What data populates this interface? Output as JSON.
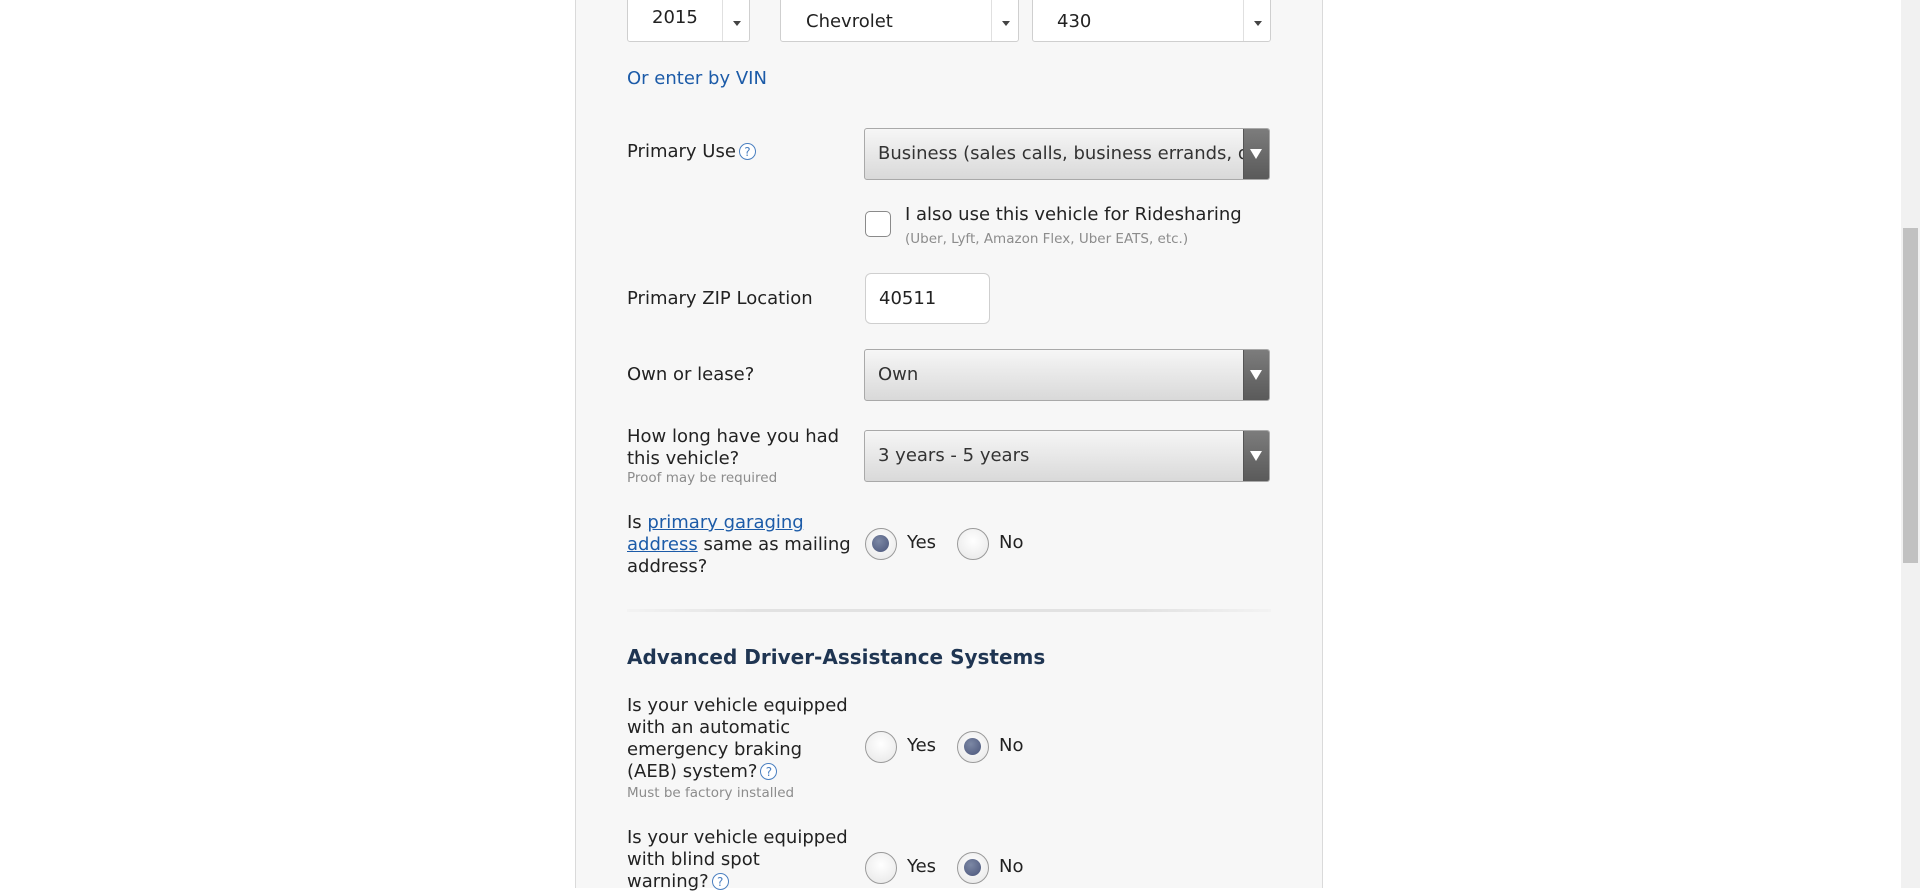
{
  "vehicle": {
    "year": "2015",
    "make": "Chevrolet",
    "model": "430",
    "vin_link": "Or enter by VIN"
  },
  "primary_use": {
    "label": "Primary Use",
    "help": "?",
    "value": "Business (sales calls, business errands, drivi"
  },
  "ridesharing": {
    "label": "I also use this vehicle for Ridesharing",
    "note": "(Uber, Lyft, Amazon Flex, Uber EATS, etc.)",
    "checked": false
  },
  "zip": {
    "label": "Primary ZIP Location",
    "value": "40511"
  },
  "own_lease": {
    "label": "Own or lease?",
    "value": "Own"
  },
  "duration": {
    "label_line1": "How long have you had",
    "label_line2": "this vehicle?",
    "note": "Proof may be required",
    "value": "3 years - 5 years"
  },
  "garaging": {
    "prefix": "Is ",
    "link_line1": "primary garaging",
    "link_line2": "address",
    "suffix_line2": " same as mailing",
    "line3": "address?",
    "yes": "Yes",
    "no": "No",
    "selected": "Yes"
  },
  "adas": {
    "title": "Advanced Driver-Assistance Systems",
    "aeb": {
      "line1": "Is your vehicle equipped",
      "line2": "with an automatic",
      "line3": "emergency braking",
      "line4": "(AEB) system?",
      "help": "?",
      "note": "Must be factory installed",
      "yes": "Yes",
      "no": "No",
      "selected": "No"
    },
    "blind_spot": {
      "line1": "Is your vehicle equipped",
      "line2": "with blind spot",
      "line3": "warning?",
      "help": "?",
      "yes": "Yes",
      "no": "No",
      "selected": "No"
    }
  }
}
